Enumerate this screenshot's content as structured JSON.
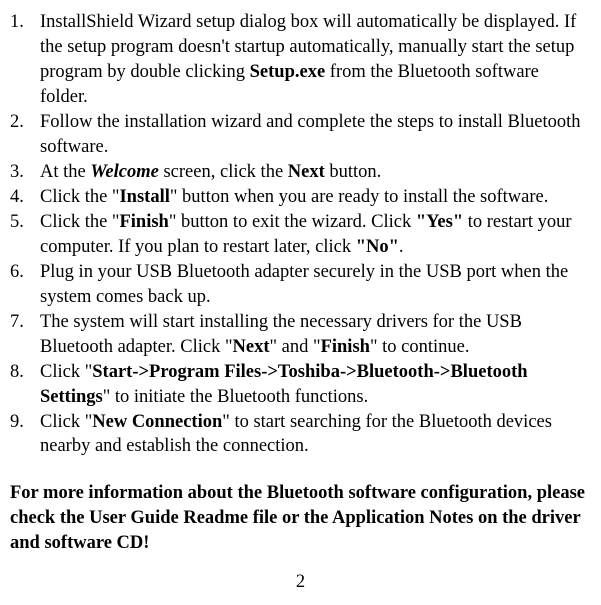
{
  "steps": [
    {
      "n": "1.",
      "pre": "InstallShield Wizard setup dialog box will automatically be displayed. If the setup program doesn't startup automatically, manually start the setup program by double clicking ",
      "b1": "Setup.exe",
      "post": " from the Bluetooth software folder."
    },
    {
      "n": "2.",
      "pre": "Follow the installation wizard and complete the steps to install Bluetooth software."
    },
    {
      "n": "3.",
      "pre": "At the ",
      "bi1": "Welcome",
      "mid1": " screen, click the ",
      "b1": "Next",
      "post": " button."
    },
    {
      "n": "4.",
      "pre": "Click the \"",
      "b1": "Install",
      "post": "\" button when you are ready to install the software."
    },
    {
      "n": "5.",
      "pre": "Click the \"",
      "b1": "Finish",
      "mid1": "\" button to exit the wizard. Click ",
      "b2": "\"Yes\"",
      "mid2": " to restart your computer. If you plan to restart later, click ",
      "b3": "\"No\"",
      "post": "."
    },
    {
      "n": "6.",
      "pre": "Plug in your USB Bluetooth adapter securely in the USB port when the system comes back up."
    },
    {
      "n": "7.",
      "pre": "The system will start installing the necessary drivers for the USB Bluetooth adapter. Click \"",
      "b1": "Next",
      "mid1": "\" and \"",
      "b2": "Finish",
      "post": "\" to continue."
    },
    {
      "n": "8.",
      "pre": "Click \"",
      "b1": "Start->Program Files->Toshiba->Bluetooth->Bluetooth Settings",
      "post": "\" to initiate the Bluetooth functions."
    },
    {
      "n": "9.",
      "pre": "Click \"",
      "b1": "New Connection",
      "post": "\" to start searching for the Bluetooth devices nearby and establish the connection."
    }
  ],
  "footer_info": "For more information about the Bluetooth software configuration, please check the User Guide Readme file or the Application Notes on the driver and software CD!",
  "page_number": "2"
}
